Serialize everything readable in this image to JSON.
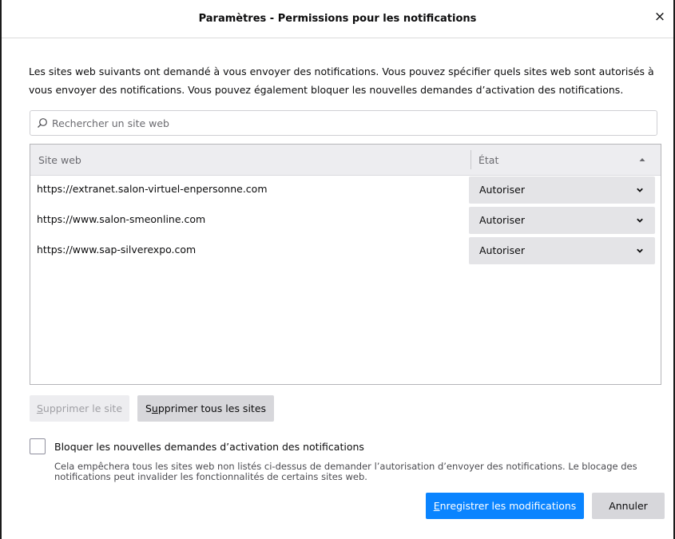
{
  "dialog": {
    "title": "Paramètres - Permissions pour les notifications",
    "close_glyph": "×"
  },
  "description": "Les sites web suivants ont demandé à vous envoyer des notifications. Vous pouvez spécifier quels sites web sont autorisés à vous envoyer des notifications. Vous pouvez également bloquer les nouvelles demandes d’activation des notifications.",
  "search": {
    "placeholder": "Rechercher un site web",
    "value": ""
  },
  "table": {
    "columns": [
      "Site web",
      "État"
    ],
    "sort_column": "État",
    "sort_direction": "ascending",
    "rows": [
      {
        "site": "https://extranet.salon-virtuel-enpersonne.com",
        "status": "Autoriser"
      },
      {
        "site": "https://www.salon-smeonline.com",
        "status": "Autoriser"
      },
      {
        "site": "https://www.sap-silverexpo.com",
        "status": "Autoriser"
      }
    ]
  },
  "buttons": {
    "remove_site": {
      "mnemonic": "S",
      "rest": "upprimer le site",
      "disabled": true
    },
    "remove_all": {
      "before": "S",
      "mnemonic": "u",
      "rest": "pprimer tous les sites"
    },
    "save": {
      "mnemonic": "E",
      "rest": "nregistrer les modifications"
    },
    "cancel": "Annuler"
  },
  "block_new": {
    "checked": false,
    "label": "Bloquer les nouvelles demandes d’activation des notifications",
    "help": "Cela empêchera tous les sites web non listés ci-dessus de demander l’autorisation d’envoyer des notifications. Le blocage des notifications peut invalider les fonctionnalités de certains sites web."
  },
  "colors": {
    "accent": "#0a84ff",
    "button_bg": "#d7d7db",
    "select_bg": "#e4e4e7",
    "header_bg": "#ededf0"
  },
  "icons": {
    "search": "magnifier-icon",
    "sort": "sort-up-icon",
    "dropdown": "chevron-down-icon",
    "close": "close-icon"
  }
}
